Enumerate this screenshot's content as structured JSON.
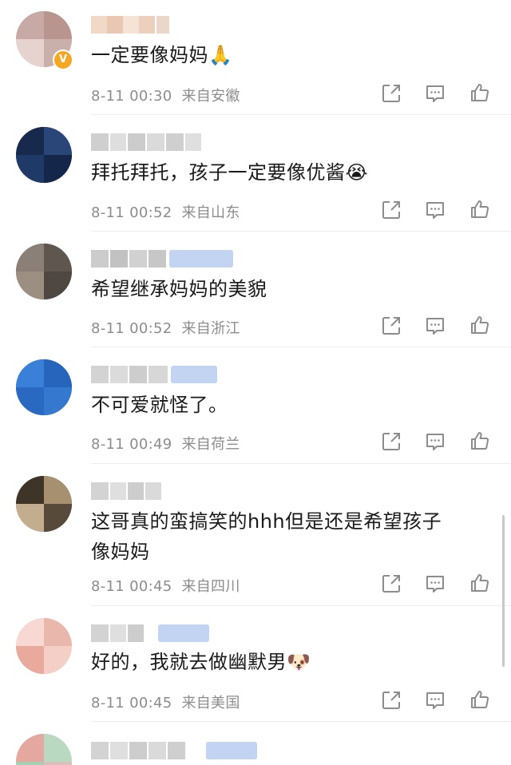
{
  "comments": [
    {
      "text": "一定要像妈妈",
      "emoji": "🙏",
      "time": "8-11 00:30",
      "location": "来自安徽"
    },
    {
      "text": "拜托拜托，孩子一定要像优酱",
      "emoji": "😭",
      "time": "8-11 00:52",
      "location": "来自山东"
    },
    {
      "text": "希望继承妈妈的美貌",
      "emoji": "",
      "time": "8-11 00:52",
      "location": "来自浙江"
    },
    {
      "text": "不可爱就怪了。",
      "emoji": "",
      "time": "8-11 00:49",
      "location": "来自荷兰"
    },
    {
      "text_line1": "这哥真的蛮搞笑的hhh但是还是希望孩子",
      "text_line2": "像妈妈",
      "time": "8-11 00:45",
      "location": "来自四川"
    },
    {
      "text": "好的，我就去做幽默男",
      "emoji": "🐶",
      "time": "8-11 00:45",
      "location": "来自美国"
    }
  ],
  "icons": {
    "share": "share-icon",
    "reply": "comment-icon",
    "like": "thumbs-up-icon",
    "verified": "verified-badge-icon"
  },
  "colors": {
    "text": "#1a1a1a",
    "meta": "#8c8c8c",
    "badge": "#f5a623",
    "tag_blue": "#8fb4ea"
  }
}
